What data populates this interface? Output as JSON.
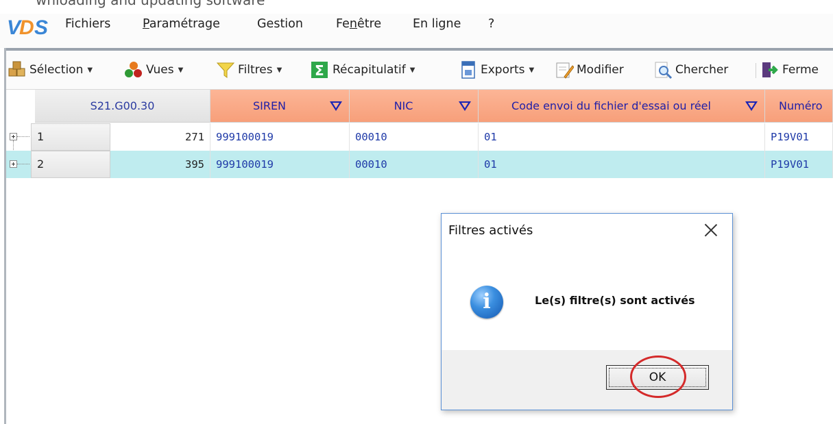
{
  "top_strip": {
    "text": "wnloading and updating software"
  },
  "menubar": {
    "logo": "VDS",
    "items": [
      {
        "label": "Fichiers",
        "mnemonic_index": -1
      },
      {
        "label": "Paramétrage",
        "mnemonic_index": 0
      },
      {
        "label": "Gestion",
        "mnemonic_index": -1
      },
      {
        "label": "Fenêtre",
        "mnemonic_index": 2
      },
      {
        "label": "En ligne",
        "mnemonic_index": -1
      },
      {
        "label": "?",
        "mnemonic_index": -1
      }
    ]
  },
  "toolbar": {
    "selection": "Sélection",
    "vues": "Vues",
    "filtres": "Filtres",
    "recapitulatif": "Récapitulatif",
    "exports": "Exports",
    "modifier": "Modifier",
    "chercher": "Chercher",
    "fermer": "Ferme"
  },
  "grid": {
    "columns": {
      "group": "S21.G00.30",
      "siren": "SIREN",
      "nic": "NIC",
      "code_envoi": "Code envoi du fichier d'essai ou réel",
      "numero": "Numéro"
    },
    "rows": [
      {
        "index": "1",
        "count": "271",
        "siren": "999100019",
        "nic": "00010",
        "code_envoi": "01",
        "numero": "P19V01"
      },
      {
        "index": "2",
        "count": "395",
        "siren": "999100019",
        "nic": "00010",
        "code_envoi": "01",
        "numero": "P19V01"
      }
    ]
  },
  "dialog": {
    "title": "Filtres activés",
    "message": "Le(s) filtre(s) sont activés",
    "ok": "OK",
    "info_icon": "i"
  },
  "colors": {
    "header_orange": "#f79f7a",
    "selected_row": "#bfecef",
    "link_blue": "#1f3aa8",
    "annotation_red": "#d42a2a"
  }
}
